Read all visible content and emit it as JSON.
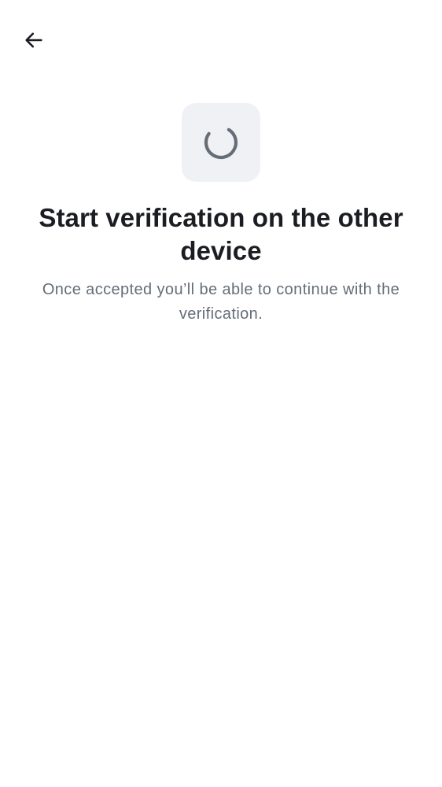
{
  "header": {
    "back_icon": "arrow-left-icon"
  },
  "status": {
    "icon": "loading-spinner-icon"
  },
  "content": {
    "title": "Start verification on the other device",
    "subtitle": "Once accepted you’ll be able to continue with the verification."
  },
  "colors": {
    "title": "#1b1d22",
    "subtitle": "#656d77",
    "icon_box_bg": "#f0f1f4",
    "spinner": "#656d77"
  }
}
